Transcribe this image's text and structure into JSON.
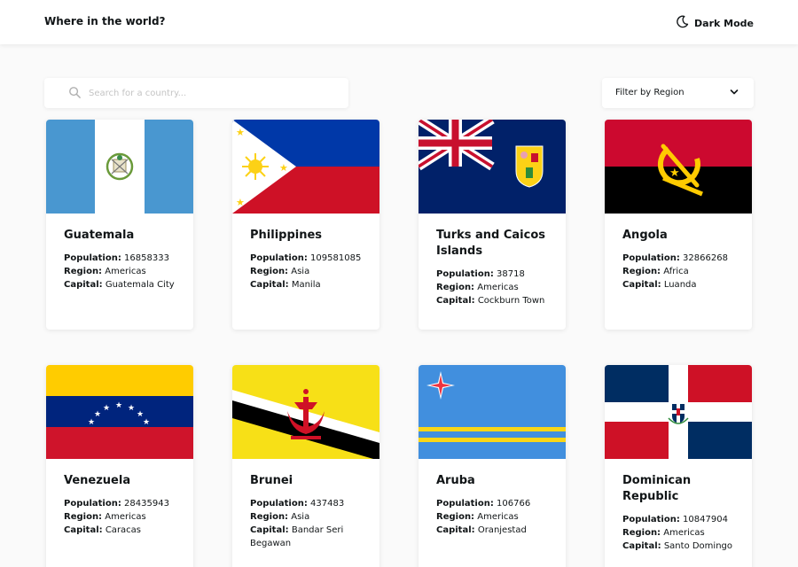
{
  "header": {
    "title": "Where in the world?",
    "mode_label": "Dark Mode",
    "mode_icon": "moon-icon"
  },
  "search": {
    "placeholder": "Search for a country...",
    "value": "",
    "icon": "search-icon"
  },
  "filter": {
    "label": "Filter by Region",
    "icon": "chevron-down-icon"
  },
  "labels": {
    "population": "Population:",
    "region": "Region:",
    "capital": "Capital:"
  },
  "countries": [
    {
      "name": "Guatemala",
      "population": "16858333",
      "region": "Americas",
      "capital": "Guatemala City"
    },
    {
      "name": "Philippines",
      "population": "109581085",
      "region": "Asia",
      "capital": "Manila"
    },
    {
      "name": "Turks and Caicos Islands",
      "population": "38718",
      "region": "Americas",
      "capital": "Cockburn Town"
    },
    {
      "name": "Angola",
      "population": "32866268",
      "region": "Africa",
      "capital": "Luanda"
    },
    {
      "name": "Venezuela",
      "population": "28435943",
      "region": "Americas",
      "capital": "Caracas"
    },
    {
      "name": "Brunei",
      "population": "437483",
      "region": "Asia",
      "capital": "Bandar Seri Begawan"
    },
    {
      "name": "Aruba",
      "population": "106766",
      "region": "Americas",
      "capital": "Oranjestad"
    },
    {
      "name": "Dominican Republic",
      "population": "10847904",
      "region": "Americas",
      "capital": "Santo Domingo"
    }
  ],
  "colors": {
    "background": "#fafafa",
    "element": "#ffffff",
    "text": "#111517",
    "placeholder": "#c4c4c4"
  }
}
